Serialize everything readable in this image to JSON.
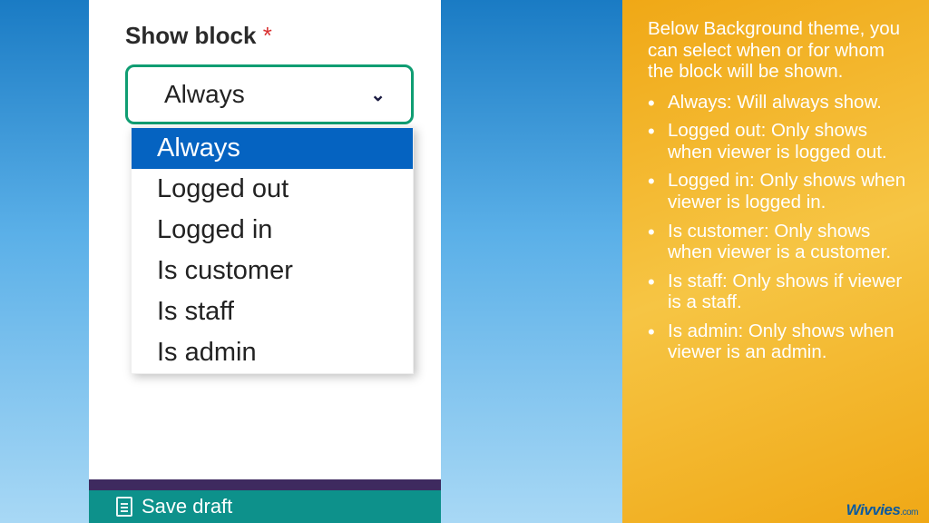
{
  "form": {
    "label": "Show block",
    "required_mark": "*",
    "selected": "Always",
    "options": [
      "Always",
      "Logged out",
      "Logged in",
      "Is customer",
      "Is staff",
      "Is admin"
    ],
    "save_label": "Save draft"
  },
  "help": {
    "intro": "Below Background theme, you can select when or for whom the block will be shown.",
    "bullets": [
      "Always: Will always show.",
      "Logged out: Only shows when viewer is logged out.",
      "Logged in: Only shows when viewer is logged in.",
      "Is customer: Only shows when viewer is a customer.",
      "Is staff: Only shows if viewer is a staff.",
      "Is admin: Only shows when viewer is an admin."
    ]
  },
  "brand": {
    "name": "Wivvies",
    "suffix": ".com"
  }
}
